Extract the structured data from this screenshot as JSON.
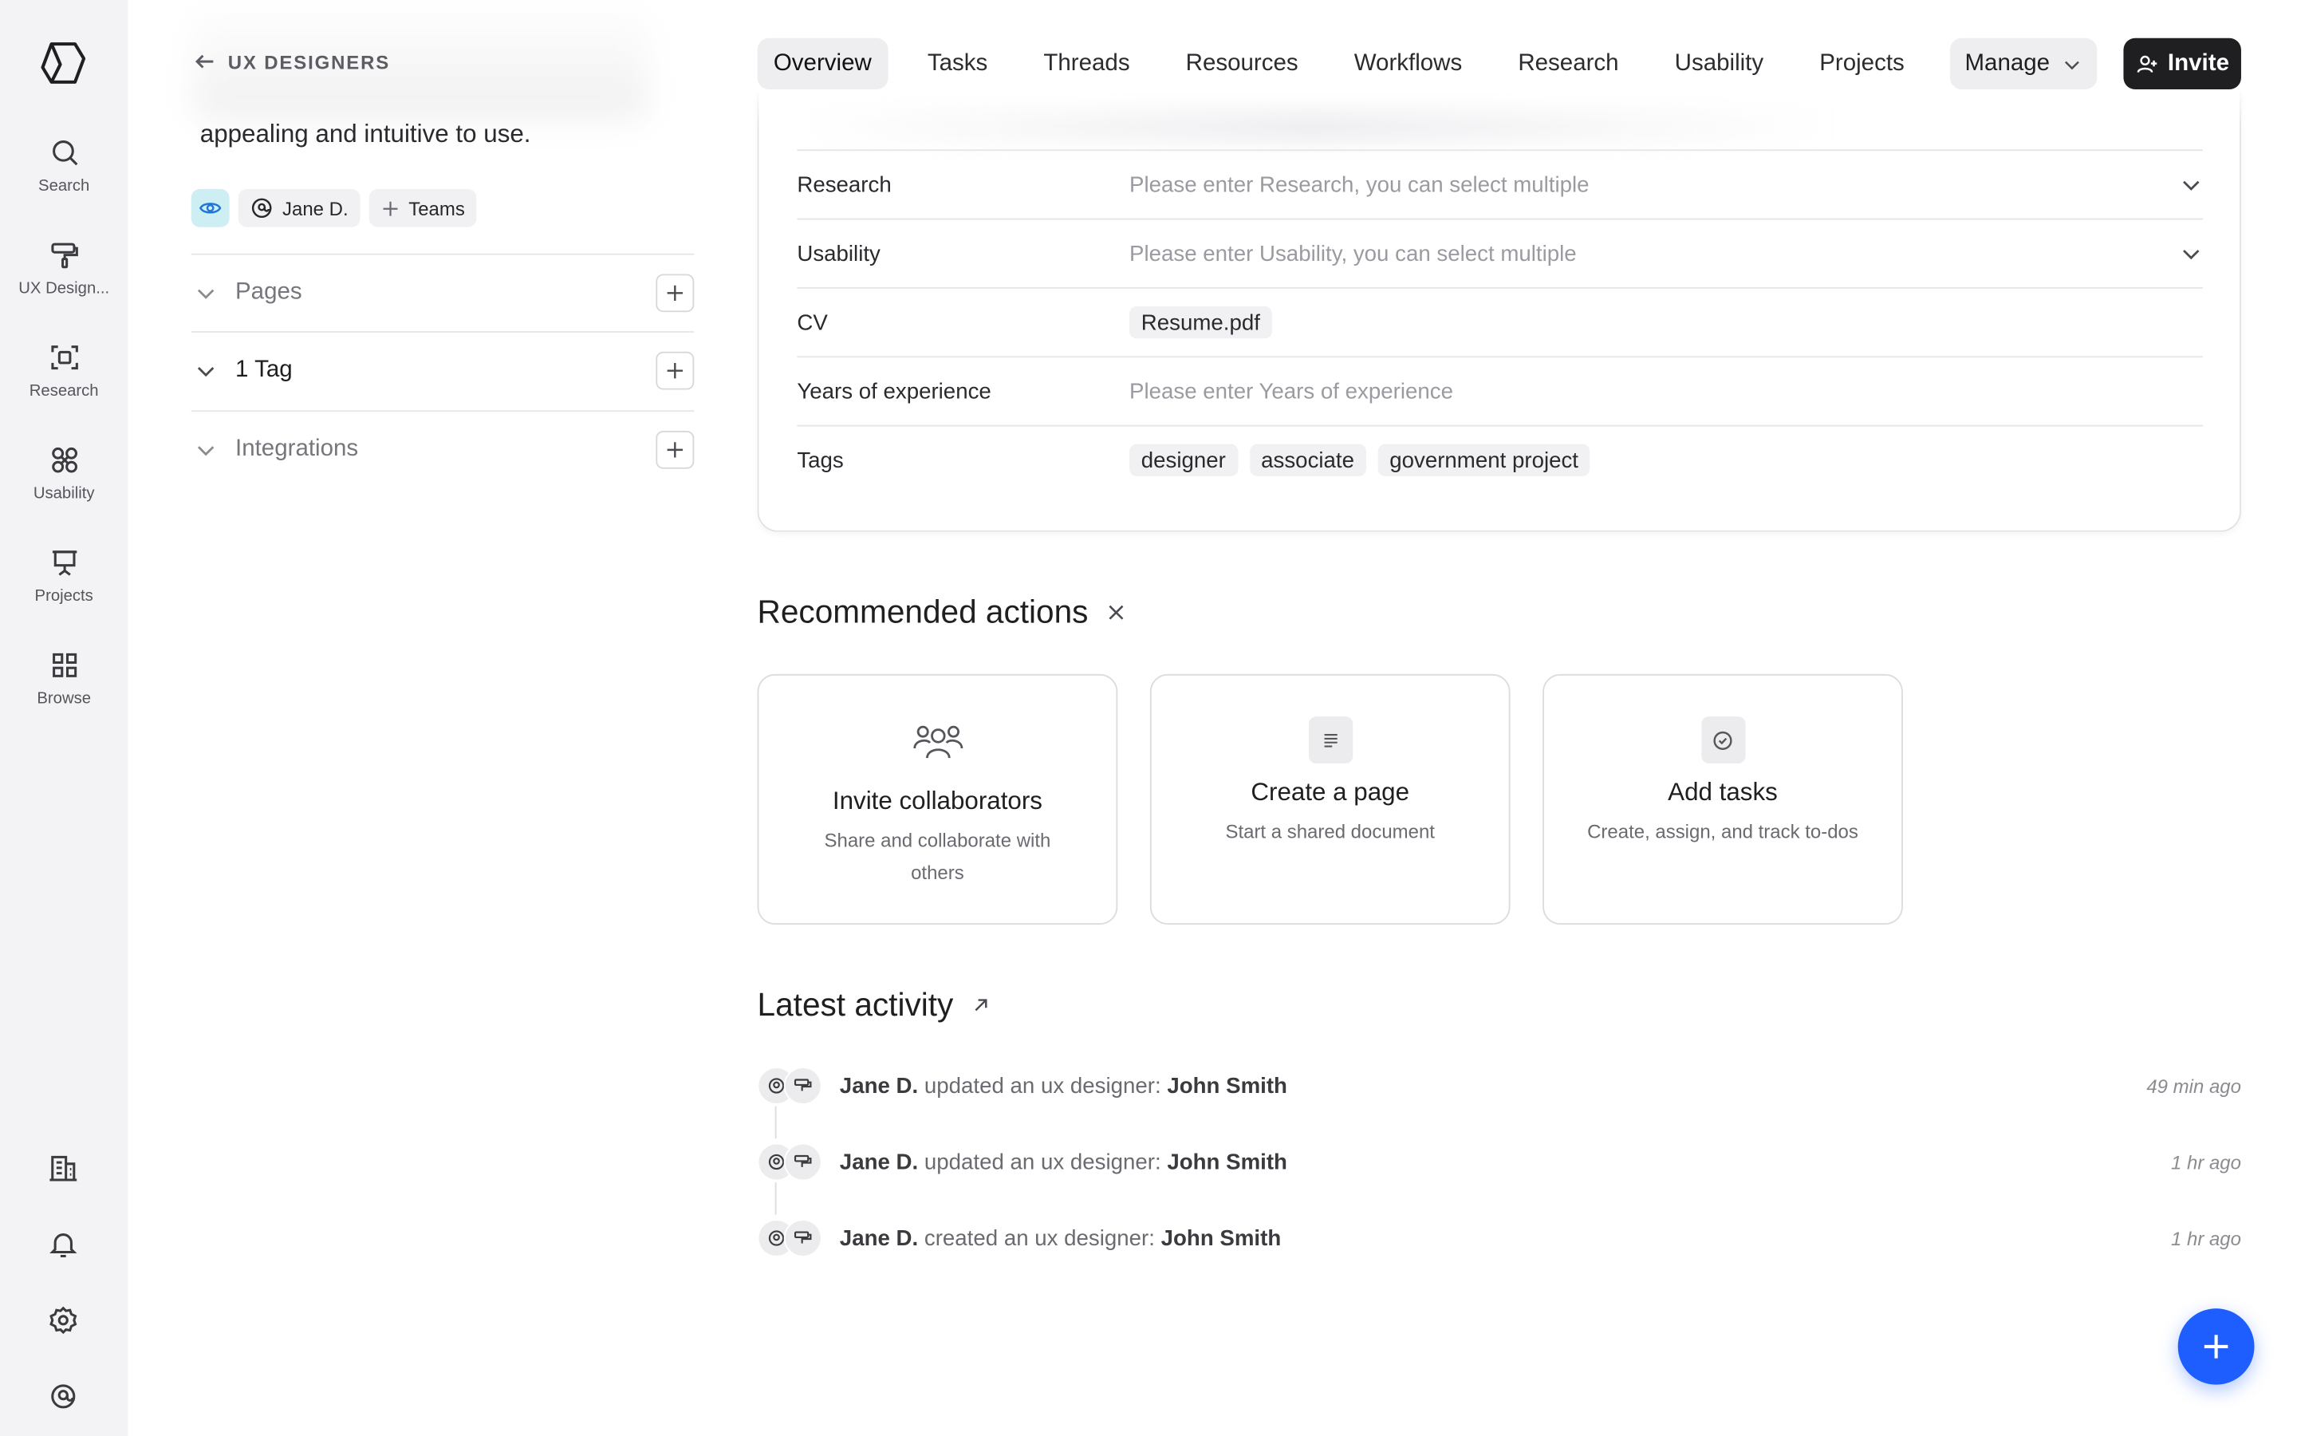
{
  "rail": {
    "items": [
      {
        "label": "Search",
        "icon": "search-icon"
      },
      {
        "label": "UX Design...",
        "icon": "paint-roller-icon"
      },
      {
        "label": "Research",
        "icon": "scan-icon"
      },
      {
        "label": "Usability",
        "icon": "command-icon"
      },
      {
        "label": "Projects",
        "icon": "presentation-icon"
      },
      {
        "label": "Browse",
        "icon": "grid-icon"
      }
    ],
    "bottom_icons": [
      "building-icon",
      "bell-icon",
      "settings-icon",
      "user-circle-icon"
    ]
  },
  "panel": {
    "back_label": "UX DESIGNERS",
    "description": "appealing and intuitive to use.",
    "chips": {
      "owner": "Jane D.",
      "teams": "Teams"
    },
    "sections": [
      {
        "label": "Pages"
      },
      {
        "label": "1 Tag"
      },
      {
        "label": "Integrations"
      }
    ]
  },
  "nav": {
    "tabs": [
      "Overview",
      "Tasks",
      "Threads",
      "Resources",
      "Workflows",
      "Research",
      "Usability",
      "Projects"
    ],
    "active_tab": "Overview",
    "manage_label": "Manage",
    "invite_label": "Invite"
  },
  "details": {
    "rows": [
      {
        "label": "Research",
        "placeholder": "Please enter Research, you can select multiple"
      },
      {
        "label": "Usability",
        "placeholder": "Please enter Usability, you can select multiple"
      },
      {
        "label": "CV",
        "file": "Resume.pdf"
      },
      {
        "label": "Years of experience",
        "placeholder": "Please enter Years of experience"
      },
      {
        "label": "Tags",
        "tags": [
          "designer",
          "associate",
          "government project"
        ]
      }
    ]
  },
  "recommended": {
    "title": "Recommended actions",
    "cards": [
      {
        "title": "Invite collaborators",
        "subtitle": "Share and collaborate with others",
        "icon": "users-icon"
      },
      {
        "title": "Create a page",
        "subtitle": "Start a shared document",
        "icon": "document-icon"
      },
      {
        "title": "Add tasks",
        "subtitle": "Create, assign, and track to-dos",
        "icon": "check-circle-icon"
      }
    ]
  },
  "activity": {
    "title": "Latest activity",
    "items": [
      {
        "actor": "Jane D.",
        "action": "updated an ux designer:",
        "target": "John Smith",
        "time": "49 min ago"
      },
      {
        "actor": "Jane D.",
        "action": "updated an ux designer:",
        "target": "John Smith",
        "time": "1 hr ago"
      },
      {
        "actor": "Jane D.",
        "action": "created an ux designer:",
        "target": "John Smith",
        "time": "1 hr ago"
      }
    ]
  },
  "colors": {
    "accent": "#1e5eff",
    "invite_bg": "#1f1f22",
    "eye_chip": "#cdeef2"
  }
}
